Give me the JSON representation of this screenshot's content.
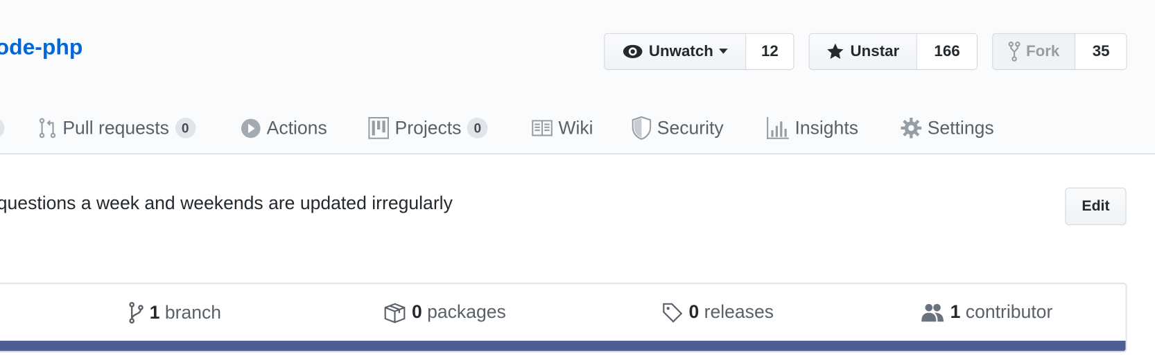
{
  "repo": {
    "title": "ode-php"
  },
  "actions": {
    "watch": {
      "label": "Unwatch",
      "count": "12"
    },
    "star": {
      "label": "Unstar",
      "count": "166"
    },
    "fork": {
      "label": "Fork",
      "count": "35"
    }
  },
  "tabs": [
    {
      "label": "Pull requests",
      "count": "0",
      "icon": "git-pull-request-icon"
    },
    {
      "label": "Actions",
      "icon": "play-icon"
    },
    {
      "label": "Projects",
      "count": "0",
      "icon": "project-icon"
    },
    {
      "label": "Wiki",
      "icon": "book-icon"
    },
    {
      "label": "Security",
      "icon": "shield-icon"
    },
    {
      "label": "Insights",
      "icon": "graph-icon"
    },
    {
      "label": "Settings",
      "icon": "gear-icon"
    }
  ],
  "description": {
    "text": "questions a week and weekends are updated irregularly",
    "edit_label": "Edit"
  },
  "stats": [
    {
      "value": "1",
      "label": "branch",
      "icon": "git-branch-icon"
    },
    {
      "value": "0",
      "label": "packages",
      "icon": "package-icon"
    },
    {
      "value": "0",
      "label": "releases",
      "icon": "tag-icon"
    },
    {
      "value": "1",
      "label": "contributor",
      "icon": "people-icon"
    }
  ],
  "colors": {
    "link": "#0366d6",
    "language_bar": "#4f5d95"
  }
}
